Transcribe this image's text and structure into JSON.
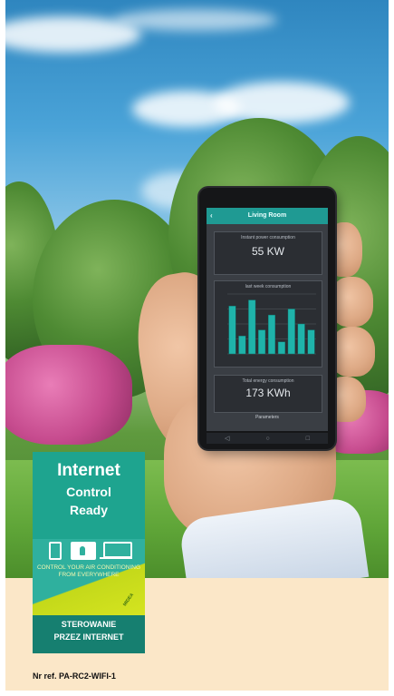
{
  "phone": {
    "title": "Living Room",
    "back_icon": "arrow-left-icon",
    "instant_label": "Instant power consumption",
    "instant_value": "55 KW",
    "last_week_label": "last week consumption",
    "total_label": "Total energy consumption",
    "total_value": "173 KWh",
    "button_label": "Parameters",
    "nav_icons": [
      "back-icon",
      "home-icon",
      "recent-icon"
    ]
  },
  "chart_data": {
    "type": "bar",
    "title": "last week consumption",
    "categories": [
      "",
      "",
      "",
      "",
      "",
      "",
      "",
      "",
      ""
    ],
    "values": [
      80,
      30,
      90,
      40,
      65,
      20,
      75,
      50,
      40
    ],
    "ylim": [
      0,
      100
    ],
    "colors": {
      "bar": "#1fb3aa",
      "bar_edge": "#0e6f69",
      "grid": "#555a61"
    }
  },
  "badge": {
    "headline": "Internet",
    "line2": "Control",
    "line3": "Ready",
    "device_icons": [
      "phone-icon",
      "tablet-touch-icon",
      "laptop-icon"
    ],
    "message": "CONTROL YOUR AIR CONDITIONING FROM EVERYWHERE",
    "stamp": "MIDEA",
    "footer_line1": "STEROWANIE",
    "footer_line2": "PRZEZ INTERNET",
    "colors": {
      "primary": "#2fb09e",
      "dark": "#167f70",
      "accent": "#c4d91a"
    }
  },
  "reference": "Nr ref. PA-RC2-WIFI-1"
}
